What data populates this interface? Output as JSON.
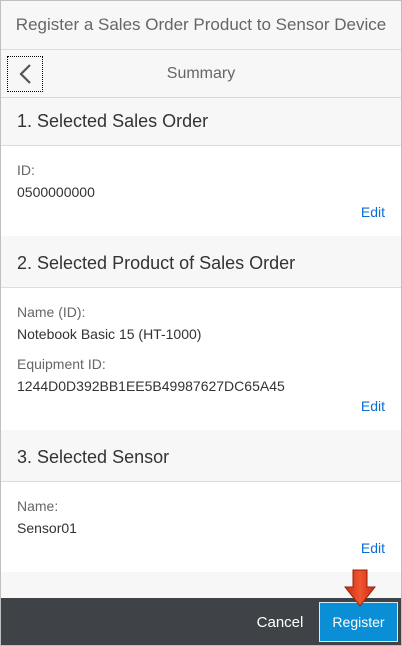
{
  "window": {
    "title": "Register a Sales Order Product to Sensor Device"
  },
  "header": {
    "title": "Summary",
    "back_icon": "chevron-left-icon"
  },
  "sections": [
    {
      "title": "1. Selected Sales Order",
      "fields": [
        {
          "label": "ID:",
          "value": "0500000000"
        }
      ],
      "edit_label": "Edit"
    },
    {
      "title": "2. Selected Product of Sales Order",
      "fields": [
        {
          "label": "Name (ID):",
          "value": "Notebook Basic 15 (HT-1000)"
        },
        {
          "label": "Equipment ID:",
          "value": "1244D0D392BB1EE5B49987627DC65A45"
        }
      ],
      "edit_label": "Edit"
    },
    {
      "title": "3. Selected Sensor",
      "fields": [
        {
          "label": "Name:",
          "value": "Sensor01"
        }
      ],
      "edit_label": "Edit"
    }
  ],
  "footer": {
    "cancel_label": "Cancel",
    "register_label": "Register"
  },
  "annotation": {
    "icon": "red-arrow-down-icon",
    "color": "#e03a1e"
  },
  "colors": {
    "accent": "#0a8fd6",
    "link": "#0a6ed1",
    "footer_bg": "#3f4348"
  }
}
